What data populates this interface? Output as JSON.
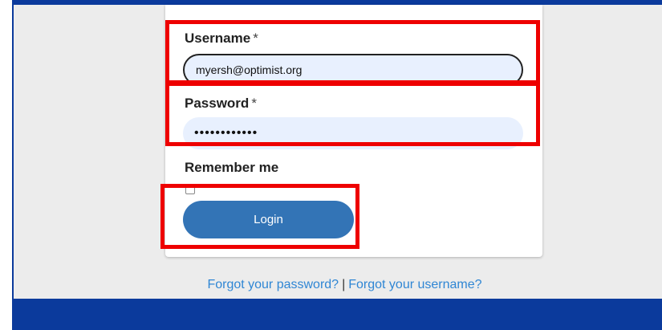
{
  "login_form": {
    "username": {
      "label": "Username",
      "required_marker": "*",
      "value": "myersh@optimist.org"
    },
    "password": {
      "label": "Password",
      "required_marker": "*",
      "masked_value": "••••••••••••"
    },
    "remember_me": {
      "label": "Remember me",
      "checked": false
    },
    "login_button": {
      "label": "Login"
    }
  },
  "footer_links": {
    "forgot_password": "Forgot your password?",
    "separator": "|",
    "forgot_username": "Forgot your username?"
  },
  "colors": {
    "brand_blue": "#0b3a9c",
    "button_blue": "#3374b6",
    "link_blue": "#2f86d4",
    "input_fill": "#e8f0fe",
    "highlight_red": "#ee0000",
    "page_background": "#ececec"
  },
  "icons": {
    "remember_checkbox": "checkbox-unchecked-icon"
  }
}
